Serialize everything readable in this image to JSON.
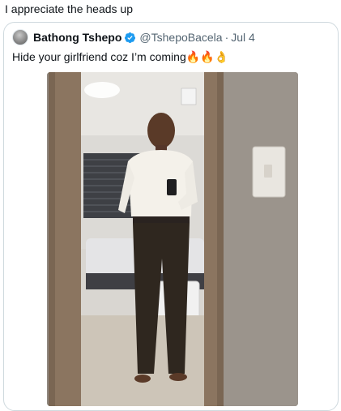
{
  "post": {
    "text": "I appreciate the heads up"
  },
  "quoted_tweet": {
    "display_name": "Bathong Tshepo",
    "handle": "@TshepoBacela",
    "separator": "·",
    "date": "Jul 4",
    "text": "Hide your girlfriend coz I’m coming🔥🔥👌",
    "verified_icon": "verified-badge-icon",
    "accent_color": "#1d9bf0",
    "media": {
      "type": "photo",
      "description_icon": "mirror-selfie-photo"
    }
  }
}
